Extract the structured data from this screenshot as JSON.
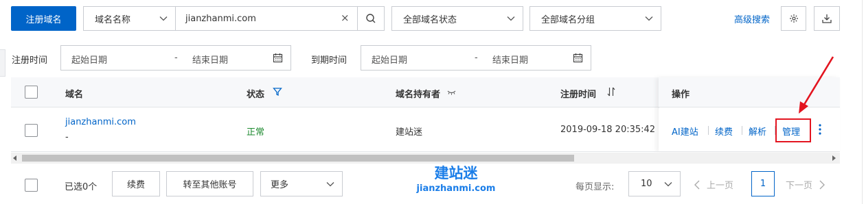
{
  "toolbar": {
    "register_button": "注册域名",
    "search_field_select": "域名名称",
    "search_value": "jianzhanmi.com",
    "clear_icon": "×",
    "status_select": "全部域名状态",
    "group_select": "全部域名分组",
    "advanced_search": "高级搜索"
  },
  "filters": {
    "register_time_label": "注册时间",
    "expire_time_label": "到期时间",
    "start_date_placeholder": "起始日期",
    "end_date_placeholder": "结束日期",
    "range_separator": "-"
  },
  "table": {
    "headers": {
      "domain": "域名",
      "status": "状态",
      "holder": "域名持有者",
      "register_time": "注册时间",
      "actions": "操作"
    },
    "rows": [
      {
        "domain": "jianzhanmi.com",
        "domain_sub": "-",
        "status": "正常",
        "holder": "建站迷",
        "register_time": "2019-09-18 20:35:42",
        "actions": [
          "AI建站",
          "续费",
          "解析",
          "管理"
        ]
      }
    ]
  },
  "footer": {
    "selected_count": "已选0个",
    "renew_button": "续费",
    "transfer_button": "转至其他账号",
    "more_select": "更多",
    "page_size_label": "每页显示:",
    "page_size_value": "10",
    "prev_label": "上一页",
    "current_page": "1",
    "next_label": "下一页"
  },
  "watermark": {
    "title": "建站迷",
    "domain": "jianzhanmi.com"
  },
  "colors": {
    "accent": "#0064c8",
    "status_ok": "#1d8a2f",
    "annotation_red": "#e3141f",
    "header_bg": "#f7f8fa"
  },
  "icons": [
    "chevron-down-icon",
    "search-icon",
    "gear-icon",
    "download-icon",
    "calendar-icon",
    "filter-icon",
    "sort-icon",
    "more-vertical-icon",
    "chevron-left-icon",
    "chevron-right-icon",
    "annotation-arrow"
  ]
}
